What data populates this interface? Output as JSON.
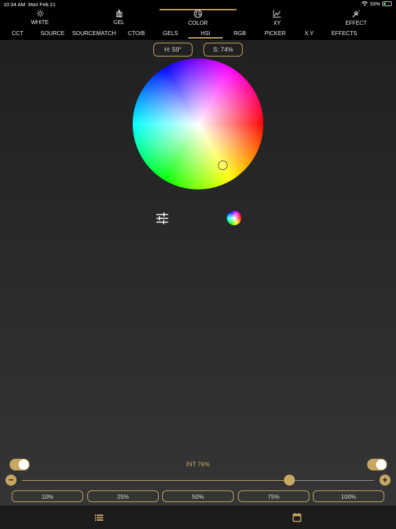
{
  "status_bar": {
    "time": "10:34 AM",
    "date": "Mon Feb 21",
    "battery": "33%",
    "battery_level": 0.33
  },
  "main_tabs": [
    {
      "label": "WHITE",
      "icon": "sun-icon"
    },
    {
      "label": "GEL",
      "icon": "gel-filter-icon"
    },
    {
      "label": "COLOR",
      "icon": "palette-icon",
      "active": true
    },
    {
      "label": "XY",
      "icon": "xy-graph-icon"
    },
    {
      "label": "EFFECT",
      "icon": "magic-wand-icon"
    }
  ],
  "sub_tabs": [
    {
      "label": "CCT"
    },
    {
      "label": "SOURCE"
    },
    {
      "label": "SOURCEMATCH"
    },
    {
      "label": "CTO/B"
    },
    {
      "label": "GELS"
    },
    {
      "label": "HSI",
      "active": true
    },
    {
      "label": "RGB"
    },
    {
      "label": "PICKER"
    },
    {
      "label": "X.Y"
    },
    {
      "label": "EFFECTS"
    }
  ],
  "hsi": {
    "hue_label": "H: 59°",
    "saturation_label": "S: 74%",
    "hue": 59,
    "saturation": 74
  },
  "intensity": {
    "label": "INT  76%",
    "value": 76,
    "left_toggle_on": true,
    "right_toggle_on": true,
    "minus_label": "−",
    "plus_label": "+"
  },
  "presets": [
    "10%",
    "25%",
    "50%",
    "75%",
    "100%"
  ],
  "bottom_bar": {
    "left_icon": "list-icon",
    "right_icon": "calendar-icon"
  },
  "colors": {
    "accent": "#c9a763",
    "background": "#262626",
    "header": "#000000"
  }
}
